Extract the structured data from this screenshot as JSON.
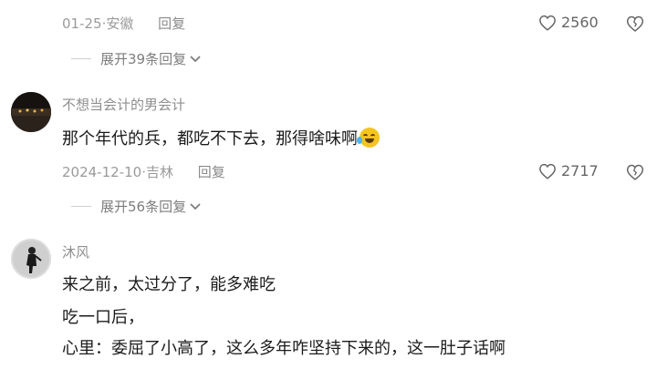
{
  "comments": [
    {
      "content": "",
      "date": "01-25",
      "location": "安徽",
      "reply_label": "回复",
      "likes": "2560",
      "expand_label": "展开39条回复"
    },
    {
      "username": "不想当会计的男会计",
      "content": "那个年代的兵，都吃不下去，那得啥味啊",
      "date": "2024-12-10",
      "location": "吉林",
      "reply_label": "回复",
      "likes": "2717",
      "expand_label": "展开56条回复"
    },
    {
      "username": "沐风",
      "content_lines": [
        "来之前，太过分了，能多难吃",
        "吃一口后，",
        "心里：委屈了小高了，这么多年咋坚持下来的，这一肚子话啊"
      ]
    }
  ],
  "separator": "·",
  "icons": {
    "like": "heart-outline-icon",
    "dislike": "heart-broken-outline-icon",
    "expand": "chevron-down-icon",
    "emoji": "laughing-tears-emoji"
  }
}
